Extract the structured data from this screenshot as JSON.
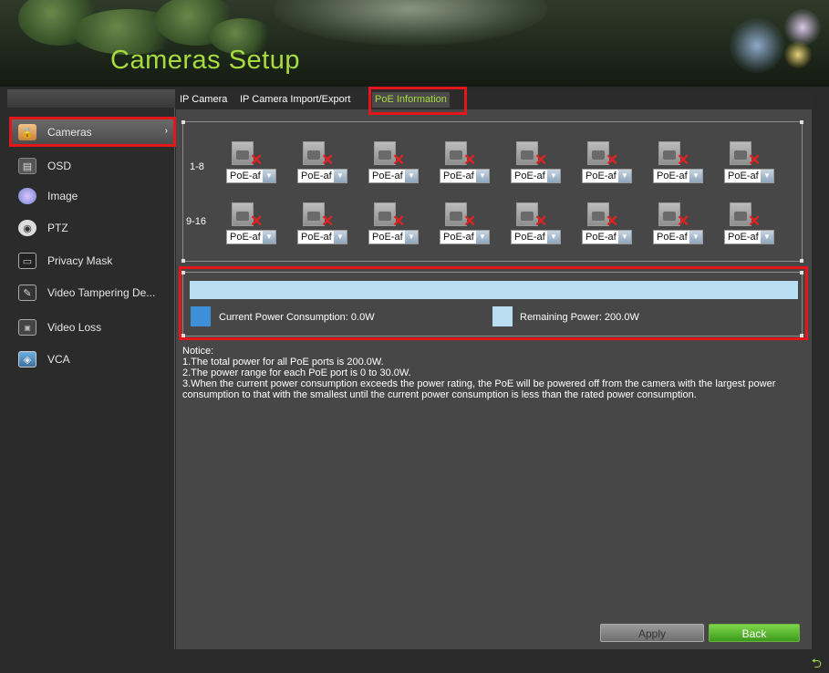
{
  "header": {
    "title": "Cameras Setup"
  },
  "sidebar": {
    "items": [
      {
        "label": "Cameras",
        "icon": "camera-lock-icon",
        "active": true
      },
      {
        "label": "OSD",
        "icon": "osd-icon"
      },
      {
        "label": "Image",
        "icon": "image-icon"
      },
      {
        "label": "PTZ",
        "icon": "ptz-icon"
      },
      {
        "label": "Privacy Mask",
        "icon": "privacy-mask-icon"
      },
      {
        "label": "Video Tampering De...",
        "icon": "video-tampering-icon"
      },
      {
        "label": "Video Loss",
        "icon": "video-loss-icon"
      },
      {
        "label": "VCA",
        "icon": "vca-icon"
      }
    ]
  },
  "tabs": [
    {
      "label": "IP Camera"
    },
    {
      "label": "IP Camera Import/Export"
    },
    {
      "label": "PoE Information",
      "active": true
    }
  ],
  "poe": {
    "rows": [
      {
        "label": "1-8",
        "ports": [
          "PoE-af",
          "PoE-af",
          "PoE-af",
          "PoE-af",
          "PoE-af",
          "PoE-af",
          "PoE-af",
          "PoE-af"
        ]
      },
      {
        "label": "9-16",
        "ports": [
          "PoE-af",
          "PoE-af",
          "PoE-af",
          "PoE-af",
          "PoE-af",
          "PoE-af",
          "PoE-af",
          "PoE-af"
        ]
      }
    ],
    "current_power_label": "Current Power Consumption: 0.0W",
    "remaining_power_label": "Remaining Power: 200.0W",
    "consumption_fraction": 0.0,
    "colors": {
      "current": "#3d8fd8",
      "remaining": "#b9def3"
    }
  },
  "notice": {
    "title": "Notice:",
    "lines": [
      "1.The total power for all PoE ports is 200.0W.",
      "2.The power range for each PoE port is 0 to 30.0W.",
      "3.When the current power consumption exceeds the power rating, the PoE will be powered off from the camera with the largest power consumption to that with the smallest until the current power consumption is less than the rated power consumption."
    ]
  },
  "buttons": {
    "apply": "Apply",
    "back": "Back"
  },
  "colors": {
    "accent": "#a7dc3f",
    "highlight": "#e3161b"
  }
}
